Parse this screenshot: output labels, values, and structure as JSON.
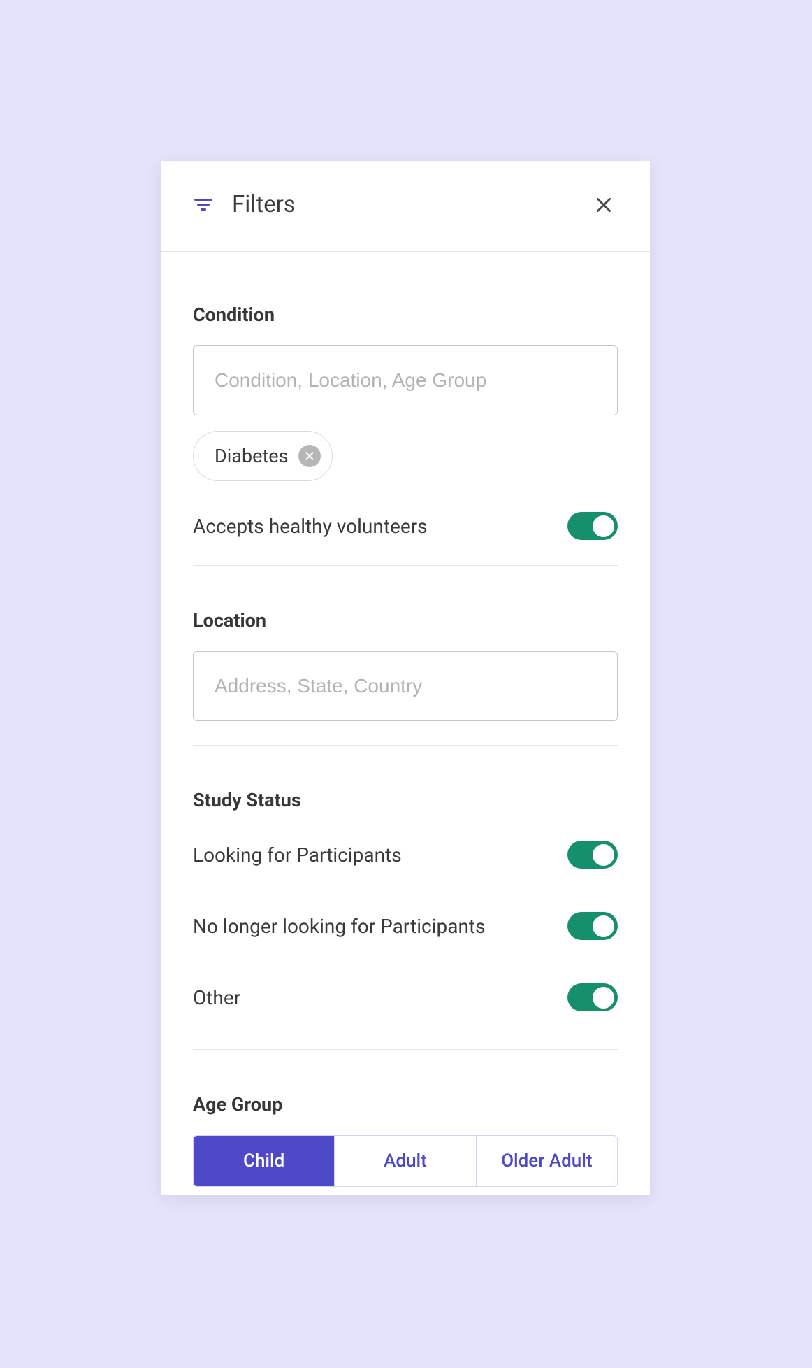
{
  "header": {
    "title": "Filters"
  },
  "condition": {
    "title": "Condition",
    "placeholder": "Condition, Location, Age Group",
    "chips": [
      {
        "label": "Diabetes"
      }
    ],
    "healthy_volunteers": {
      "label": "Accepts healthy volunteers",
      "value": true
    }
  },
  "location": {
    "title": "Location",
    "placeholder": "Address, State, Country"
  },
  "study_status": {
    "title": "Study Status",
    "items": [
      {
        "label": "Looking for Participants",
        "value": true
      },
      {
        "label": "No longer looking for Participants",
        "value": true
      },
      {
        "label": "Other",
        "value": true
      }
    ]
  },
  "age_group": {
    "title": "Age Group",
    "options": [
      {
        "label": "Child",
        "active": true
      },
      {
        "label": "Adult",
        "active": false
      },
      {
        "label": "Older Adult",
        "active": false
      }
    ]
  },
  "colors": {
    "accent": "#4E49C9",
    "toggle_on": "#168F6D",
    "page_bg": "#E4E3FB"
  }
}
